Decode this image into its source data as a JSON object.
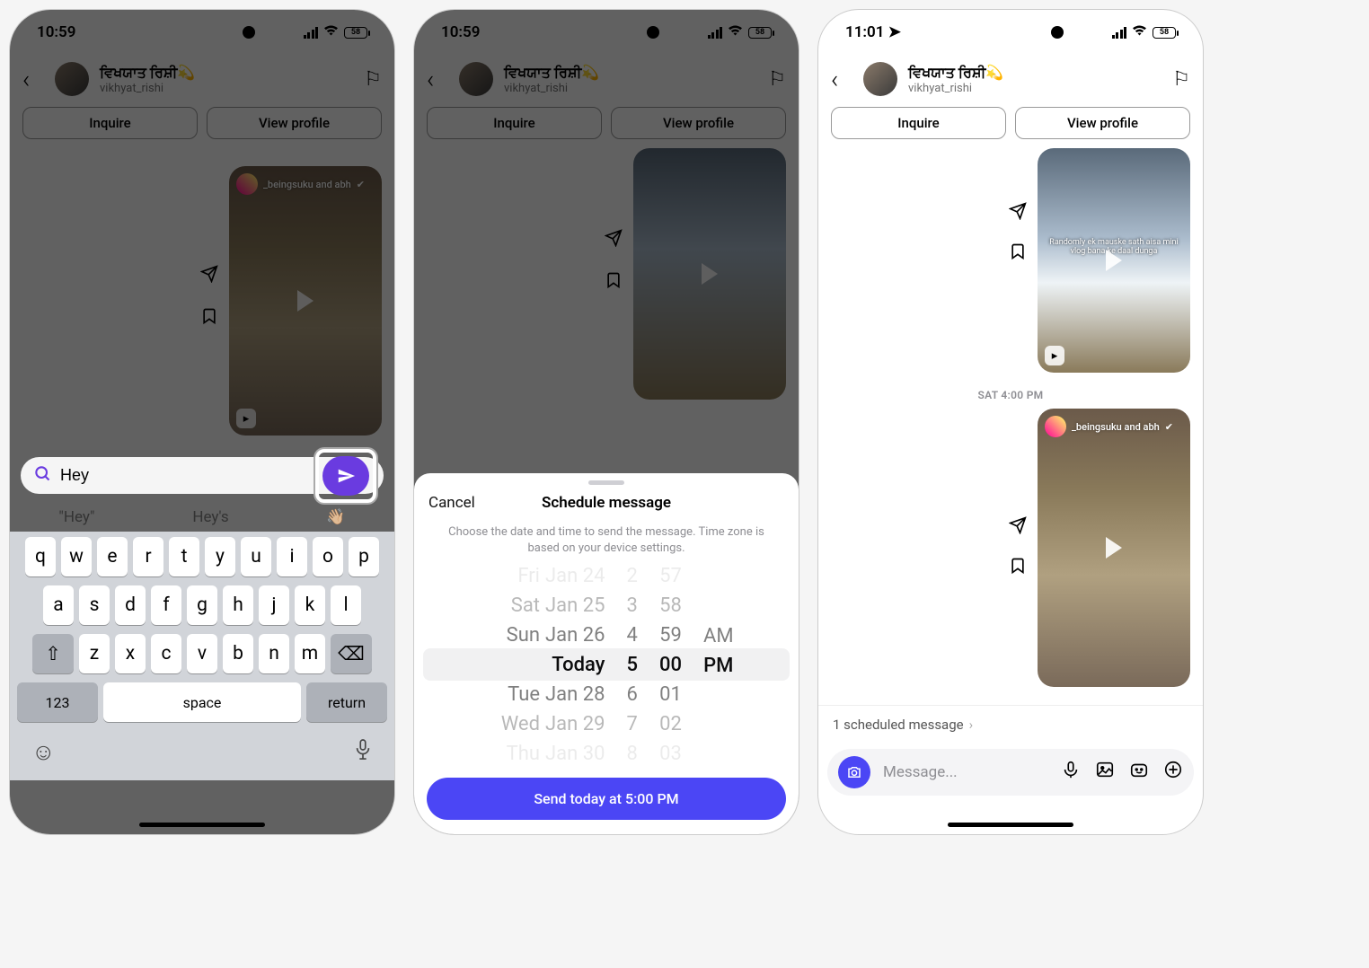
{
  "status": {
    "time_a": "10:59",
    "time_b": "10:59",
    "time_c": "11:01",
    "battery": "58"
  },
  "contact": {
    "display_name": "ਵਿਖਯਾਤ ਰਿਸ਼ੀ",
    "emoji": "💫",
    "username": "vikhyat_rishi"
  },
  "actions": {
    "inquire": "Inquire",
    "view_profile": "View profile"
  },
  "screen_a": {
    "reel_user": "_beingsuku and abh",
    "input_value": "Hey",
    "suggestions": [
      "\"Hey\"",
      "Hey's",
      "👋🏼"
    ]
  },
  "keyboard": {
    "row1": [
      "q",
      "w",
      "e",
      "r",
      "t",
      "y",
      "u",
      "i",
      "o",
      "p"
    ],
    "row2": [
      "a",
      "s",
      "d",
      "f",
      "g",
      "h",
      "j",
      "k",
      "l"
    ],
    "row3": [
      "z",
      "x",
      "c",
      "v",
      "b",
      "n",
      "m"
    ],
    "num": "123",
    "space": "space",
    "ret": "return"
  },
  "sheet": {
    "cancel": "Cancel",
    "title": "Schedule message",
    "desc": "Choose the date and time to send the message. Time zone is based on your device settings.",
    "dates_above": [
      {
        "dow": "Fri",
        "md": "Jan 24"
      },
      {
        "dow": "Sat",
        "md": "Jan 25"
      },
      {
        "dow": "Sun",
        "md": "Jan 26"
      }
    ],
    "date_sel": "Today",
    "dates_below": [
      {
        "dow": "Tue",
        "md": "Jan 28"
      },
      {
        "dow": "Wed",
        "md": "Jan 29"
      },
      {
        "dow": "Thu",
        "md": "Jan 30"
      }
    ],
    "hours": [
      "2",
      "3",
      "4",
      "5",
      "6",
      "7",
      "8"
    ],
    "mins": [
      "57",
      "58",
      "59",
      "00",
      "01",
      "02",
      "03"
    ],
    "ampm_above": "AM",
    "ampm_sel": "PM",
    "button": "Send today at 5:00 PM"
  },
  "screen_c": {
    "reel1_caption": "Randomly ek mauske sath aisa mini vlog bana ke daal dunga",
    "timestamp": "SAT 4:00 PM",
    "reel2_user": "_beingsuku and abh",
    "sched_bar": "1 scheduled message",
    "placeholder": "Message..."
  }
}
